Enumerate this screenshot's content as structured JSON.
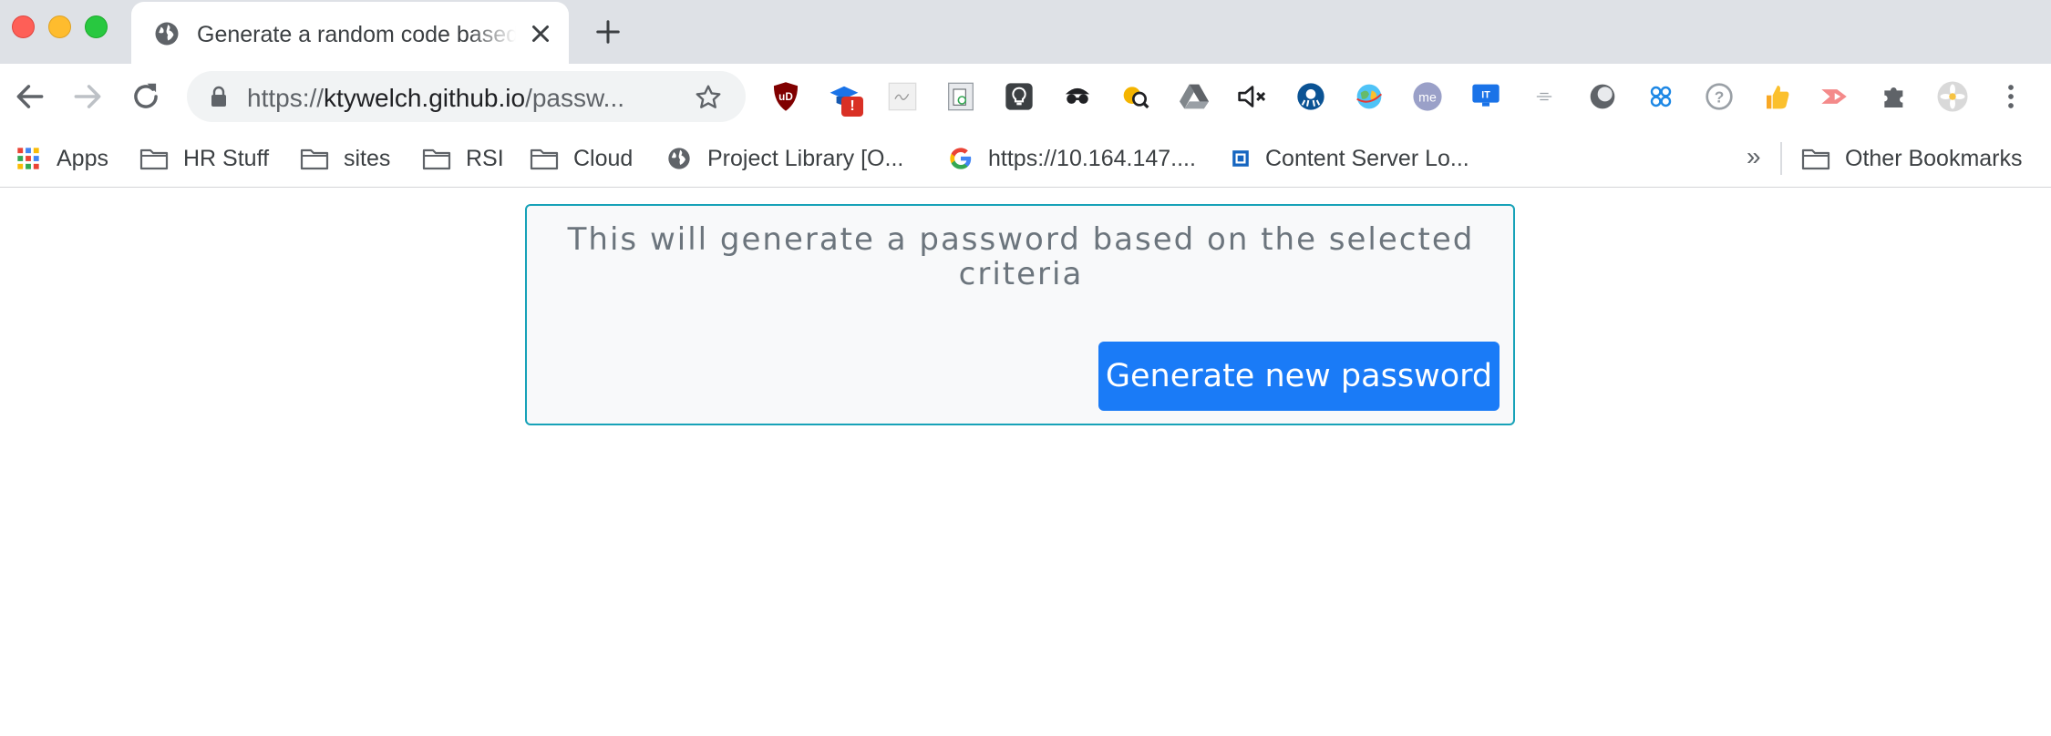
{
  "tab": {
    "title": "Generate a random code based on selected criteria",
    "close_icon": "close-icon",
    "favicon": "globe-icon"
  },
  "toolbar": {
    "url_scheme": "https://",
    "url_host": "ktywelch.github.io",
    "url_path": "/passw..."
  },
  "extensions": {
    "shield_badge": "!"
  },
  "bookmarks": [
    {
      "label": "Apps",
      "icon": "apps-grid-icon"
    },
    {
      "label": "HR Stuff",
      "icon": "folder-icon"
    },
    {
      "label": "sites",
      "icon": "folder-icon"
    },
    {
      "label": "RSI",
      "icon": "folder-icon"
    },
    {
      "label": "Cloud",
      "icon": "folder-icon"
    },
    {
      "label": "Project Library [O...",
      "icon": "globe-icon"
    },
    {
      "label": "https://10.164.147....",
      "icon": "google-icon"
    },
    {
      "label": "Content Server Lo...",
      "icon": "content-server-icon"
    }
  ],
  "bookmarks_overflow": "»",
  "other_bookmarks": "Other Bookmarks",
  "card": {
    "text": "This will generate a password based on the selected criteria",
    "button_label": "Generate new password"
  },
  "colors": {
    "card_border": "#17a2b8",
    "button_bg": "#1a7bf7",
    "text_muted": "#6c757d"
  }
}
